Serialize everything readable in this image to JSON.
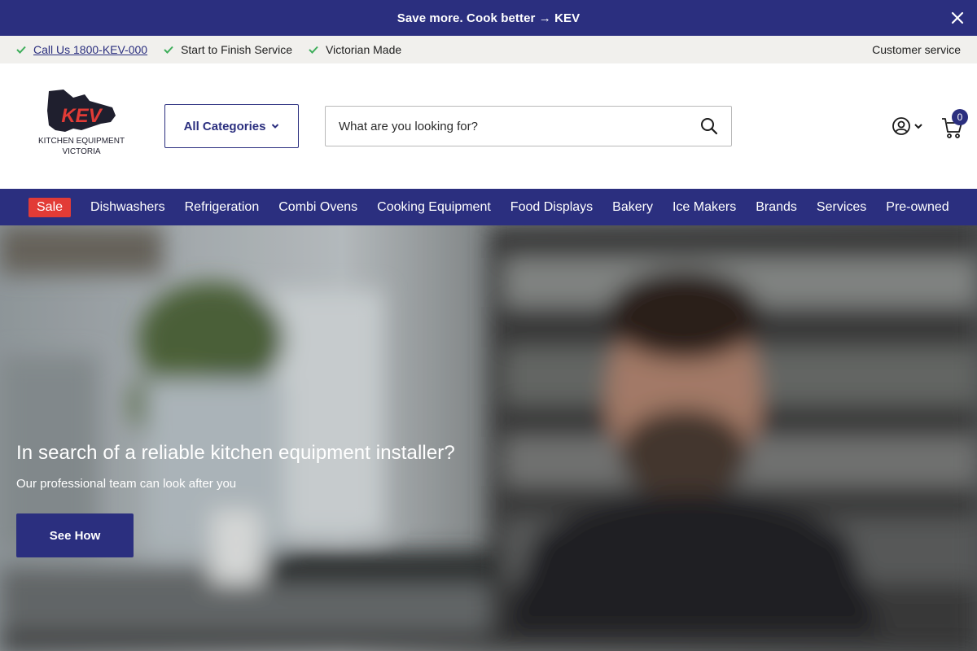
{
  "announcement": {
    "text": "Save more. Cook better → KEV"
  },
  "utility": {
    "items": [
      "Call Us 1800-KEV-000",
      "Start to Finish Service",
      "Victorian Made"
    ],
    "customer_service": "Customer service"
  },
  "header": {
    "logo_text": "KEV",
    "logo_line1": "KITCHEN EQUIPMENT",
    "logo_line2": "VICTORIA",
    "categories_label": "All Categories",
    "search_placeholder": "What are you looking for?",
    "cart_count": "0"
  },
  "nav": {
    "sale": "Sale",
    "items": [
      "Dishwashers",
      "Refrigeration",
      "Combi Ovens",
      "Cooking Equipment",
      "Food Displays",
      "Bakery",
      "Ice Makers",
      "Brands",
      "Services",
      "Pre-owned"
    ]
  },
  "hero": {
    "title": "In search of a reliable kitchen equipment installer?",
    "subtitle": "Our professional team can look after you",
    "button": "See How"
  },
  "colors": {
    "brand": "#2b2f7f",
    "sale": "#e23b36",
    "check": "#3fae5b",
    "util_bg": "#f1f0ed"
  }
}
